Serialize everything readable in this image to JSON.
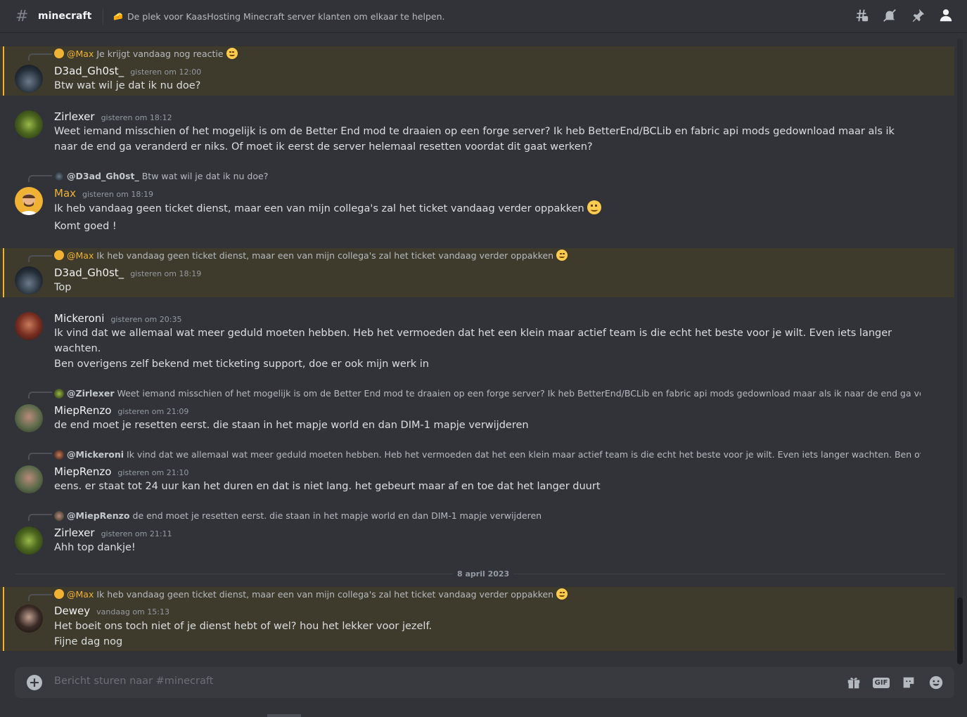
{
  "header": {
    "channel": "minecraft",
    "topic": "De plek voor KaasHosting Minecraft server klanten om elkaar te helpen."
  },
  "messages": [
    {
      "reply": {
        "name": "@Max",
        "text": "Je krijgt vandaag nog reactie"
      },
      "author": "D3ad_Gh0st_",
      "time": "gisteren om 12:00",
      "lines": [
        "Btw wat wil je dat ik nu doe?"
      ]
    },
    {
      "author": "Zirlexer",
      "time": "gisteren om 18:12",
      "lines": [
        "Weet iemand misschien of het mogelijk is om de Better End mod te draaien op een forge server? Ik heb BetterEnd/BCLib en fabric api mods gedownload maar als ik naar de end ga veranderd er niks. Of moet ik eerst de server helemaal resetten voordat dit gaat werken?"
      ]
    },
    {
      "reply": {
        "name": "@D3ad_Gh0st_",
        "text": "Btw wat wil je dat ik nu doe?"
      },
      "author": "Max",
      "time": "gisteren om 18:19",
      "lines": [
        "Ik heb vandaag geen ticket dienst, maar een van mijn collega's zal het ticket vandaag verder oppakken",
        "Komt goed !"
      ]
    },
    {
      "reply": {
        "name": "@Max",
        "text": "Ik heb vandaag geen ticket dienst, maar een van mijn collega's zal het ticket vandaag verder oppakken"
      },
      "author": "D3ad_Gh0st_",
      "time": "gisteren om 18:19",
      "lines": [
        "Top"
      ]
    },
    {
      "author": "Mickeroni",
      "time": "gisteren om 20:35",
      "lines": [
        "Ik vind dat we allemaal wat meer geduld moeten hebben. Heb het vermoeden dat het een klein maar actief team is die echt het beste voor je wilt. Even iets langer wachten.",
        "Ben overigens zelf bekend met ticketing support, doe er ook mijn werk in"
      ]
    },
    {
      "reply": {
        "name": "@Zirlexer",
        "text": "Weet iemand misschien of het mogelijk is om de Better End mod te draaien op een forge server? Ik heb BetterEnd/BCLib en fabric api mods gedownload maar als ik naar de end ga veranderd er niks"
      },
      "author": "MiepRenzo",
      "time": "gisteren om 21:09",
      "lines": [
        "de end moet je resetten eerst. die staan in het mapje world en dan DIM-1 mapje verwijderen"
      ]
    },
    {
      "reply": {
        "name": "@Mickeroni",
        "text": "Ik vind dat we allemaal wat meer geduld moeten hebben. Heb het vermoeden dat het een klein maar actief team is die echt het beste voor je wilt. Even iets langer wachten. Ben overigens zelf bekend"
      },
      "author": "MiepRenzo",
      "time": "gisteren om 21:10",
      "lines": [
        "eens. er staat tot 24 uur kan het duren en dat is niet lang. het gebeurt maar af en toe dat het langer duurt"
      ]
    },
    {
      "reply": {
        "name": "@MiepRenzo",
        "text": "de end moet je resetten eerst. die staan in het mapje world en dan DIM-1 mapje verwijderen"
      },
      "author": "Zirlexer",
      "time": "gisteren om 21:11",
      "lines": [
        "Ahh top dankje!"
      ]
    },
    {
      "reply": {
        "name": "@Max",
        "text": "Ik heb vandaag geen ticket dienst, maar een van mijn collega's zal het ticket vandaag verder oppakken"
      },
      "author": "Dewey",
      "time": "vandaag om 15:13",
      "lines": [
        "Het boeit ons toch niet of je dienst hebt of wel? hou het lekker voor jezelf.",
        "Fijne dag nog"
      ]
    }
  ],
  "date_divider": "8 april 2023",
  "composer": {
    "placeholder": "Bericht sturen naar #minecraft",
    "gif": "GIF"
  },
  "colors": {
    "mention_bg": "#3e3a2c",
    "mention_bar": "#f0b232",
    "max_name": "#f0b232"
  }
}
